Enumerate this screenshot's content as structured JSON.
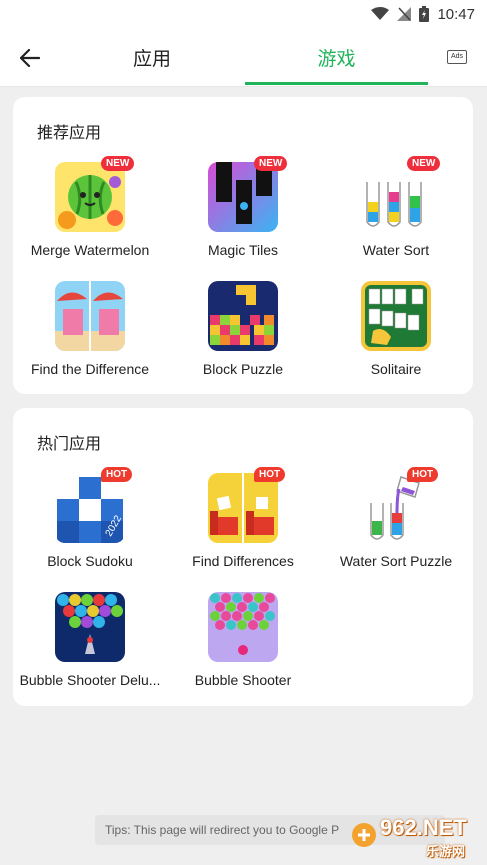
{
  "status_bar": {
    "time": "10:47"
  },
  "header": {
    "tabs": [
      {
        "label": "应用"
      },
      {
        "label": "游戏"
      }
    ],
    "ads_label": "Ads"
  },
  "sections": [
    {
      "title": "推荐应用",
      "apps": [
        {
          "name": "Merge Watermelon",
          "badge": "NEW",
          "icon": "watermelon-icon"
        },
        {
          "name": "Magic Tiles",
          "badge": "NEW",
          "icon": "piano-tiles-icon"
        },
        {
          "name": "Water Sort",
          "badge": "NEW",
          "icon": "test-tubes-icon"
        },
        {
          "name": "Find the Difference",
          "badge": "",
          "icon": "beach-scene-icon"
        },
        {
          "name": "Block Puzzle",
          "badge": "",
          "icon": "gem-blocks-icon"
        },
        {
          "name": "Solitaire",
          "badge": "",
          "icon": "playing-cards-icon"
        }
      ]
    },
    {
      "title": "热门应用",
      "apps": [
        {
          "name": "Block Sudoku",
          "badge": "HOT",
          "icon": "blue-blocks-icon",
          "year": "2022"
        },
        {
          "name": "Find Differences",
          "badge": "HOT",
          "icon": "red-sofa-icon"
        },
        {
          "name": "Water Sort Puzzle",
          "badge": "HOT",
          "icon": "pouring-tubes-icon"
        },
        {
          "name": "Bubble Shooter Delu...",
          "badge": "",
          "icon": "bubble-deluxe-icon"
        },
        {
          "name": "Bubble Shooter",
          "badge": "",
          "icon": "bubbles-icon"
        }
      ]
    }
  ],
  "toast": "Tips: This page will redirect you to Google P",
  "watermark": {
    "number": "962.NET",
    "text": "乐游网"
  },
  "colors": {
    "accent": "#1fb45a",
    "badge": "#ee2f3b"
  }
}
